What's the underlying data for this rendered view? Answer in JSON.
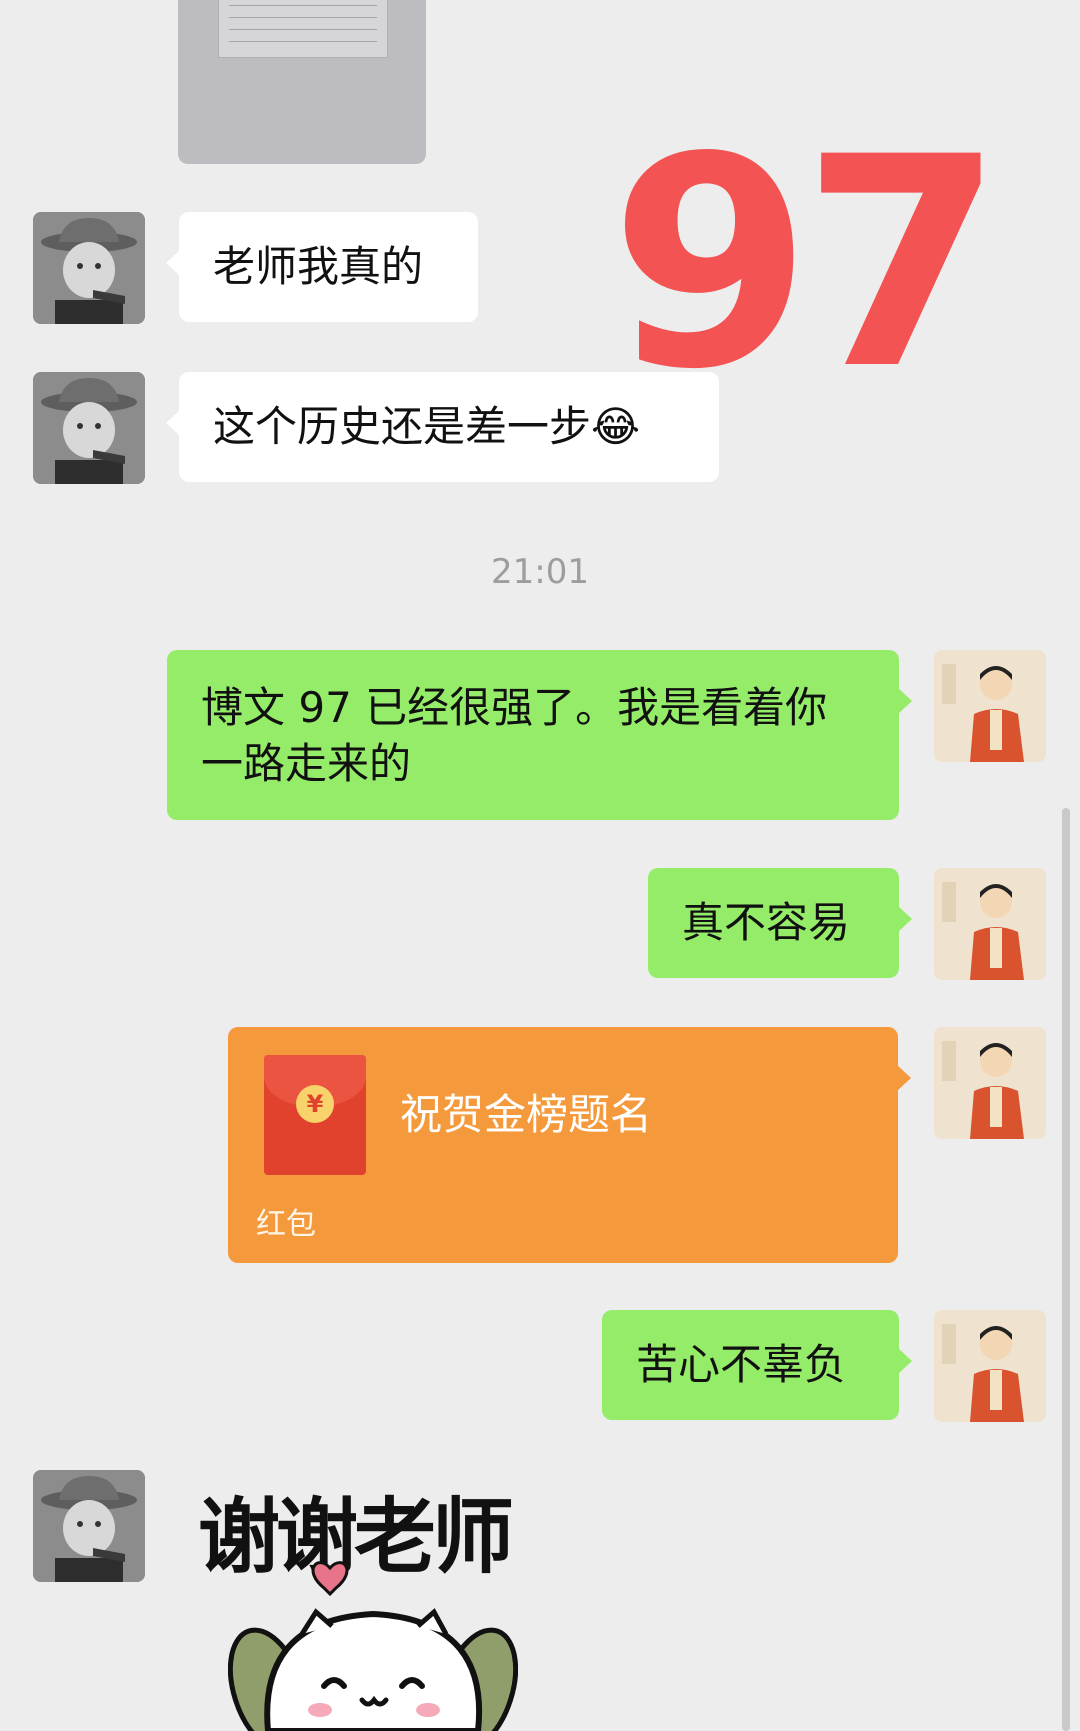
{
  "overlay_number": "97",
  "messages": {
    "m1": "老师我真的",
    "m2": "这个历史还是差一步",
    "m2_emoji": "😂",
    "timestamp": "21:01",
    "m3_line1": "博文 97 已经很强了。我是看着你",
    "m3_line2": "一路走来的",
    "m4": "真不容易",
    "m5": "苦心不辜负"
  },
  "red_packet": {
    "title": "祝贺金榜题名",
    "label": "红包",
    "coin_symbol": "¥"
  },
  "sticker": {
    "text": "谢谢老师"
  },
  "colors": {
    "background": "#ededed",
    "incoming_bubble": "#ffffff",
    "outgoing_bubble": "#95ec69",
    "red_packet": "#f59a3c",
    "overlay_number": "#f35353"
  }
}
